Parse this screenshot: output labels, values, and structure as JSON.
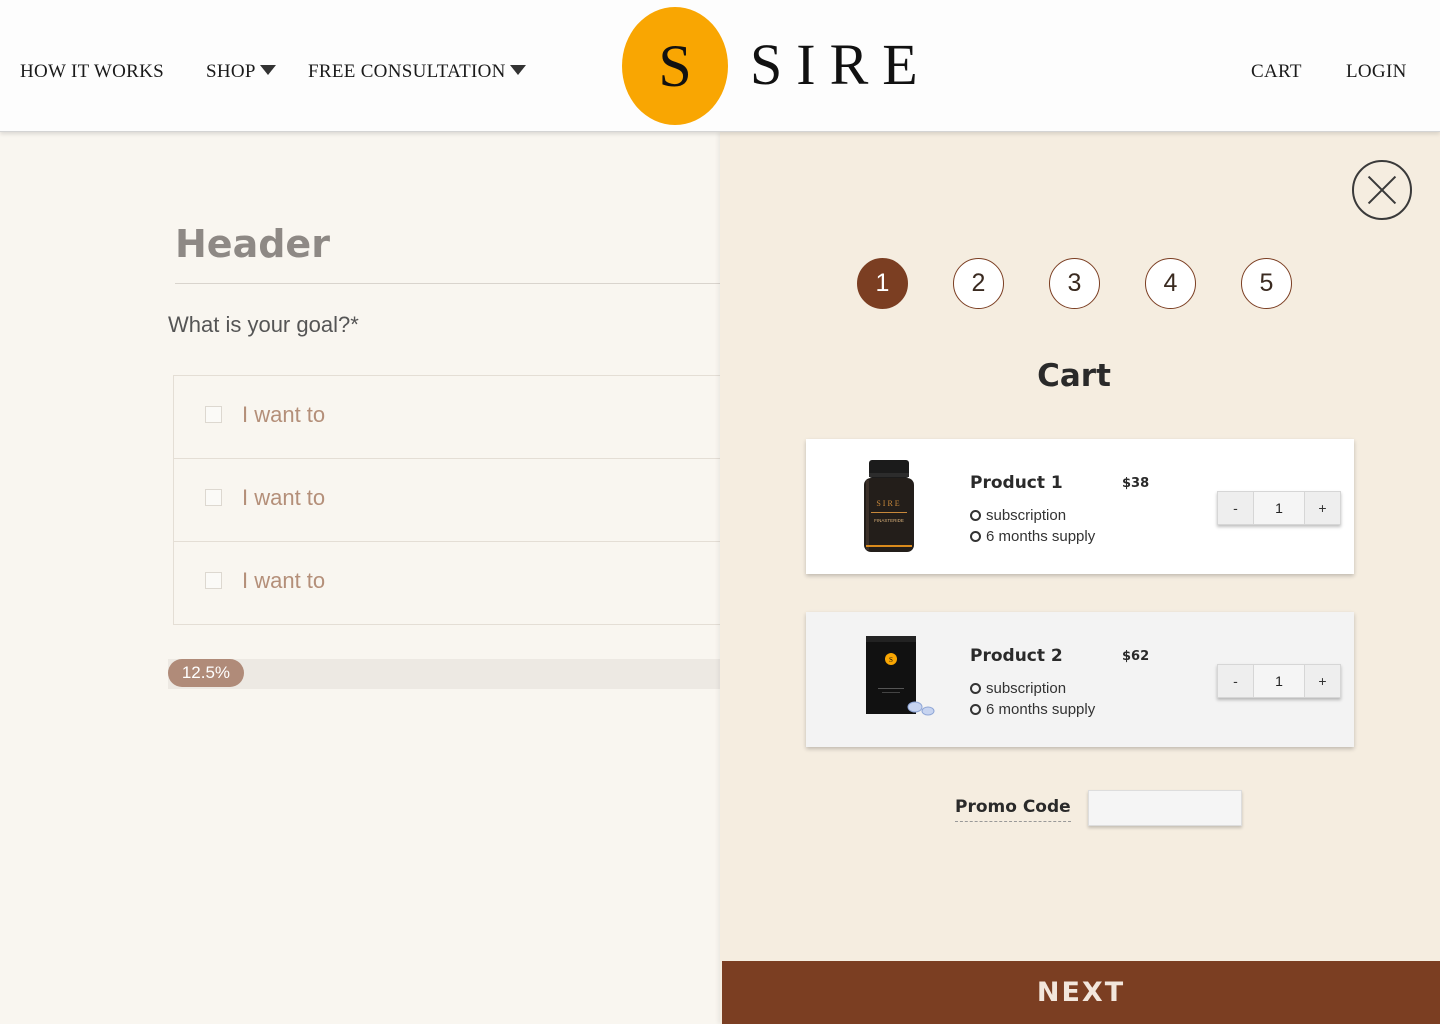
{
  "nav": {
    "how_it_works": "HOW IT WORKS",
    "shop": "SHOP",
    "free_consultation": "FREE CONSULTATION",
    "cart": "CART",
    "login": "LOGIN"
  },
  "brand": {
    "logo_letter": "S",
    "name": "SIRE",
    "accent_color": "#f9a602"
  },
  "questionnaire": {
    "header": "Header",
    "question": "What is your goal?*",
    "options": [
      "I want to",
      "I want to",
      "I want to"
    ],
    "progress_label": "12.5%",
    "progress_fraction": 0.125
  },
  "cart": {
    "steps": [
      "1",
      "2",
      "3",
      "4",
      "5"
    ],
    "active_step": 1,
    "title": "Cart",
    "items": [
      {
        "name": "Product 1",
        "price": "$38",
        "option1": "subscription",
        "option2": "6 months supply",
        "qty": "1",
        "minus": "-",
        "plus": "+"
      },
      {
        "name": "Product 2",
        "price": "$62",
        "option1": "subscription",
        "option2": "6 months supply",
        "qty": "1",
        "minus": "-",
        "plus": "+"
      }
    ],
    "product1_bottle_text": "SIRE",
    "product1_bottle_subtext": "FINASTERIDE",
    "product2_pouch_letter": "S",
    "promo_label": "Promo Code",
    "promo_value": "",
    "next_label": "NEXT",
    "brand_brown": "#7b3e22"
  }
}
